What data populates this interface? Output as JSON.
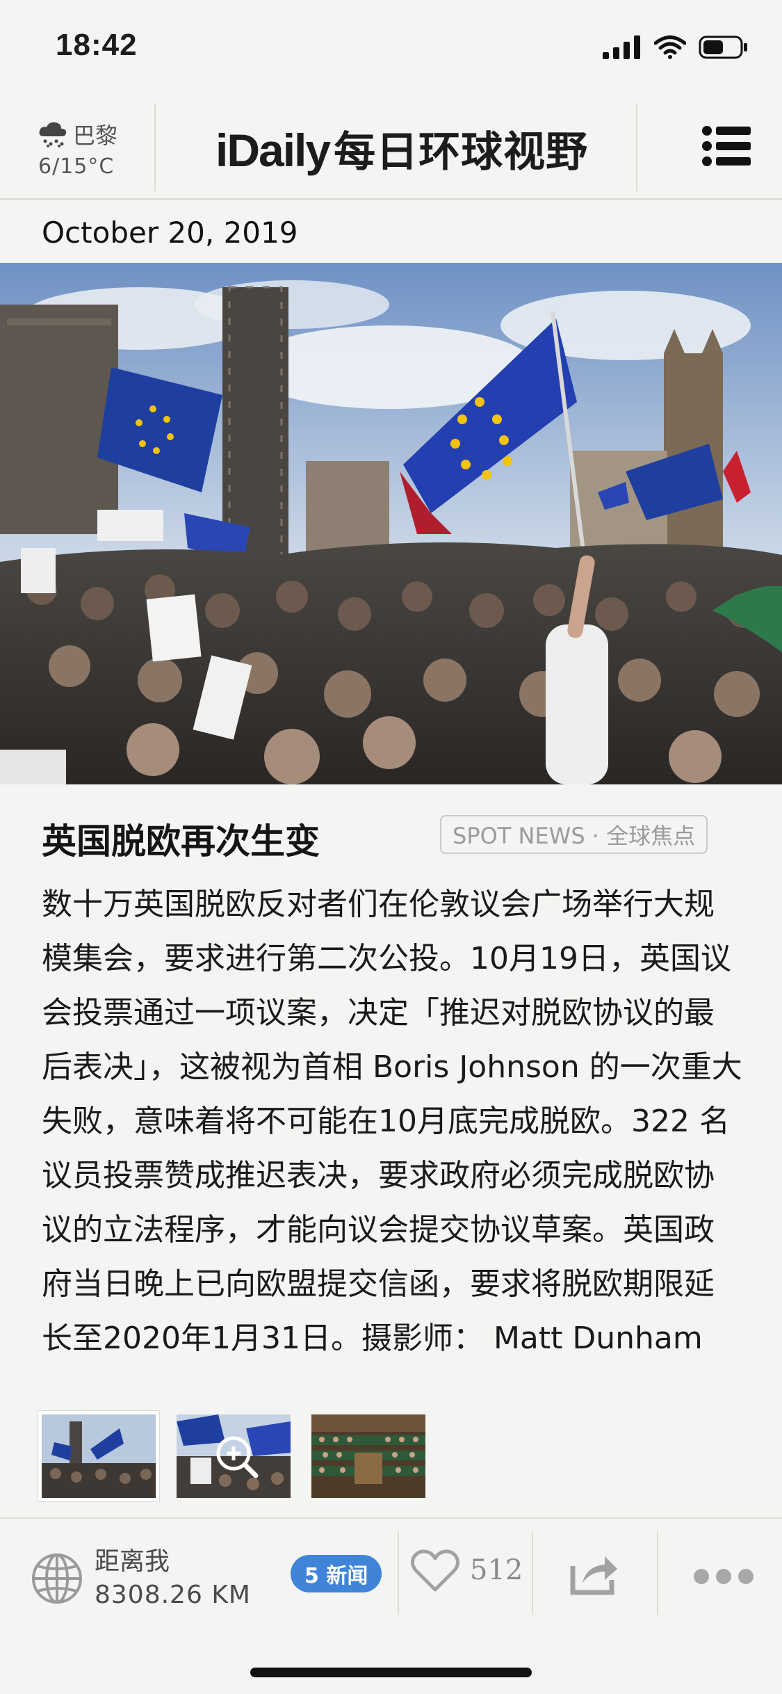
{
  "status_bar": {
    "time": "18:42"
  },
  "header": {
    "weather": {
      "city": "巴黎",
      "temp": "6/15°C",
      "icon": "snow-cloud-icon"
    },
    "brand_latin": "iDaily",
    "brand_cjk": "每日环球视野",
    "menu_icon": "list-menu-icon"
  },
  "date": "October 20, 2019",
  "article": {
    "title": "英国脱欧再次生变",
    "tag": "SPOT NEWS · 全球焦点",
    "body": "数十万英国脱欧反对者们在伦敦议会广场举行大规模集会，要求进行第二次公投。10月19日，英国议会投票通过一项议案，决定「推迟对脱欧协议的最后表决」，这被视为首相 Boris Johnson 的一次重大失败，意味着将不可能在10月底完成脱欧。322 名议员投票赞成推迟表决，要求政府必须完成脱欧协议的立法程序，才能向议会提交协议草案。英国政府当日晚上已向欧盟提交信函，要求将脱欧期限延长至2020年1月31日。摄影师： Matt Dunham"
  },
  "thumbnails": [
    {
      "name": "thumb-protest-crowd",
      "active": true
    },
    {
      "name": "thumb-eu-flags-zoom",
      "active": false
    },
    {
      "name": "thumb-parliament-chamber",
      "active": false
    }
  ],
  "bottom_bar": {
    "distance_label": "距离我",
    "distance_value": "8308.26 KM",
    "news_badge": "5 新闻",
    "like_count": "512"
  },
  "colors": {
    "accent": "#3f84d9",
    "background": "#f4f4f2",
    "eu_blue": "#1f3fa0",
    "eu_yellow": "#f2c40c"
  }
}
